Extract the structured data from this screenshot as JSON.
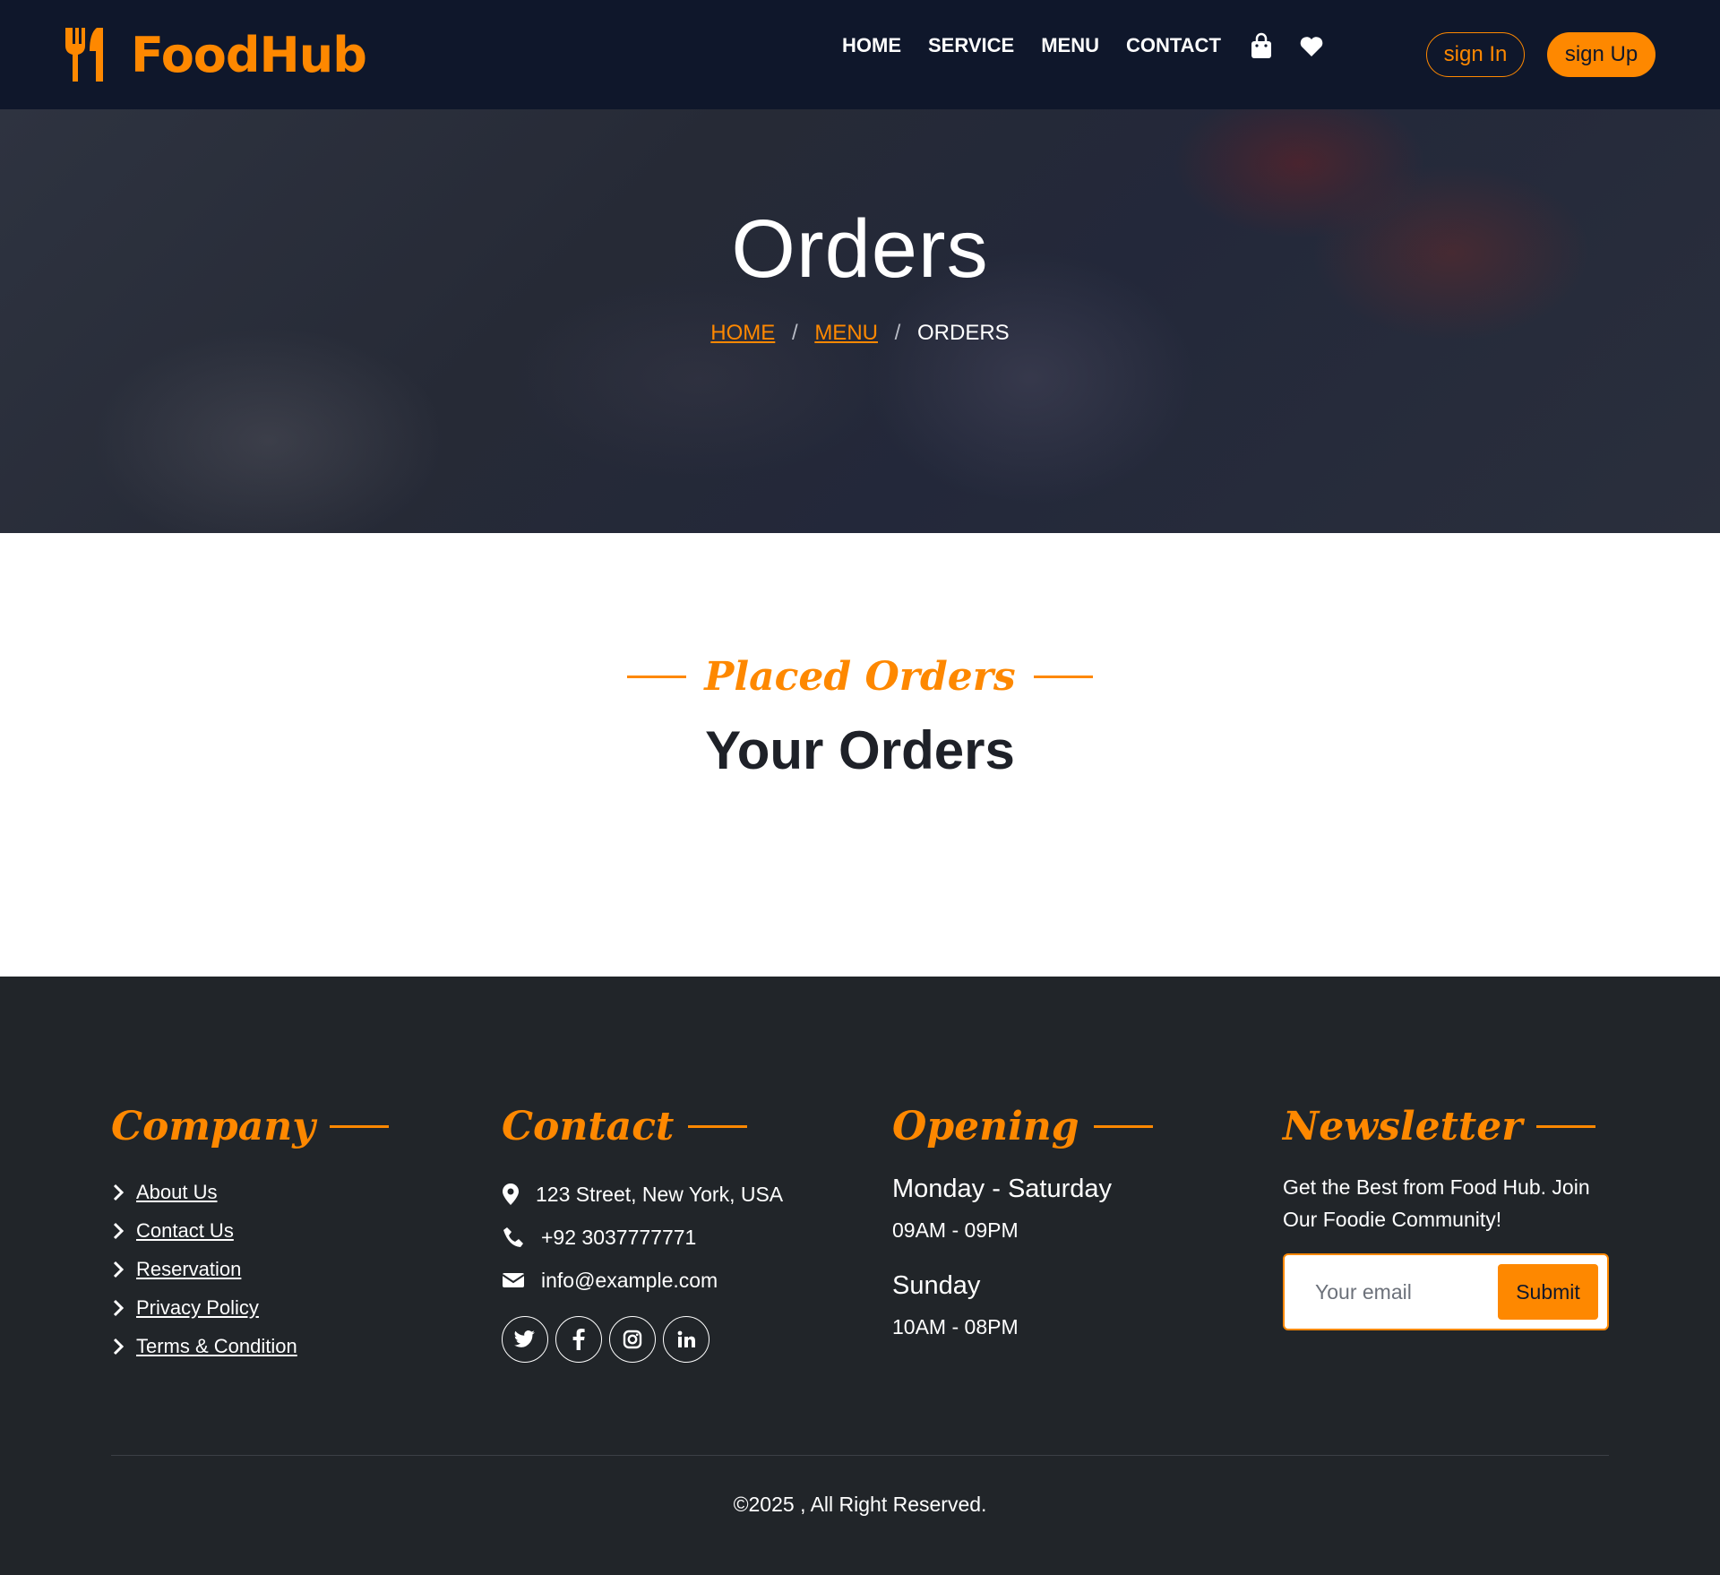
{
  "brand": {
    "name": "FoodHub",
    "icon": "utensils-icon",
    "accent": "#fe8800"
  },
  "nav": {
    "links": [
      "HOME",
      "SERVICE",
      "MENU",
      "CONTACT"
    ],
    "cart_icon": "shopping-bag-icon",
    "wishlist_icon": "heart-icon",
    "signin_label": "sign In",
    "signup_label": "sign Up"
  },
  "hero": {
    "title": "Orders",
    "breadcrumb": {
      "home": "HOME",
      "menu": "MENU",
      "current": "ORDERS",
      "separator": "/"
    }
  },
  "orders_section": {
    "subtitle": "Placed Orders",
    "title": "Your Orders"
  },
  "footer": {
    "company": {
      "title": "Company",
      "links": [
        "About Us",
        "Contact Us",
        "Reservation",
        "Privacy Policy",
        "Terms & Condition"
      ]
    },
    "contact": {
      "title": "Contact",
      "address": "123 Street, New York, USA",
      "phone": "+92 3037777771",
      "email": "info@example.com",
      "socials": [
        "twitter-icon",
        "facebook-icon",
        "instagram-icon",
        "linkedin-icon"
      ]
    },
    "opening": {
      "title": "Opening",
      "weekday_label": "Monday - Saturday",
      "weekday_hours": "09AM - 09PM",
      "sunday_label": "Sunday",
      "sunday_hours": "10AM - 08PM"
    },
    "newsletter": {
      "title": "Newsletter",
      "text": "Get the Best from Food Hub. Join Our Foodie Community!",
      "placeholder": "Your email",
      "submit_label": "Submit"
    },
    "copyright": "©2025 , All Right Reserved."
  },
  "colors": {
    "navbar": "#0f172b",
    "footer": "#212529",
    "accent": "#fe8800"
  }
}
